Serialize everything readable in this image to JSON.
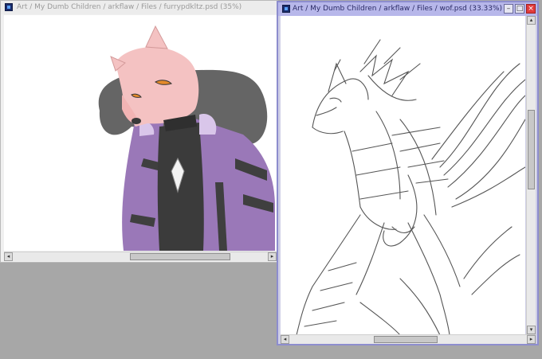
{
  "windows": {
    "left": {
      "title": "Art / My Dumb Children / arkflaw / Files / furrypdkltz.psd (35%)",
      "scroll_left_icon": "◂",
      "scroll_right_icon": "▸",
      "hscroll_position": 0.47
    },
    "right": {
      "title": "Art / My Dumb Children / arkflaw / Files / wof.psd (33.33%)",
      "buttons": {
        "minimize": "–",
        "maximize": "□",
        "close": "×"
      },
      "scroll_left_icon": "◂",
      "scroll_right_icon": "▸",
      "scroll_up_icon": "▴",
      "scroll_down_icon": "▾",
      "hscroll_position": 0.5,
      "vscroll_position": 0.45
    }
  },
  "icons": {
    "app": "paint-app-icon",
    "minimize": "minimize-icon",
    "maximize": "maximize-icon",
    "close": "close-icon"
  },
  "colors": {
    "workspace": "#a7a7a7",
    "active_border": "#8d8dce",
    "active_titlebar": "#b7b7ea",
    "inactive_titlebar": "#ececec",
    "fur_pink": "#f4c2c2",
    "jacket_purple": "#9a78b8",
    "sketch_gray": "#555555"
  }
}
